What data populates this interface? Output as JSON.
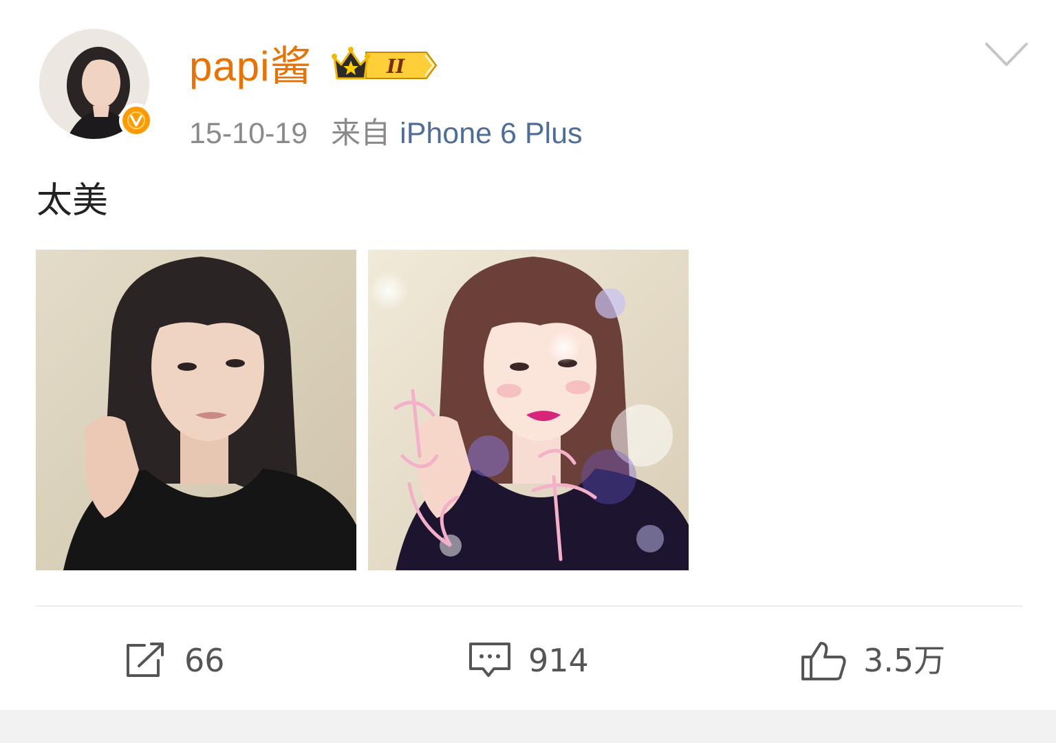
{
  "post": {
    "author": {
      "name": "papi酱",
      "verified_badge_letter": "V",
      "rank_badge_numeral": "II"
    },
    "date": "15-10-19",
    "from_label": "来自",
    "source": "iPhone 6 Plus",
    "text": "太美",
    "photos": [
      {
        "icon": "selfie-photo"
      },
      {
        "icon": "selfie-photo-filtered"
      }
    ]
  },
  "actions": {
    "repost_count": "66",
    "comment_count": "914",
    "like_count": "3.5万"
  },
  "colors": {
    "username": "#eb7100",
    "source_link": "#4d6d9a",
    "meta": "#8a8a8a",
    "verified_badge": "#ff9a00"
  }
}
